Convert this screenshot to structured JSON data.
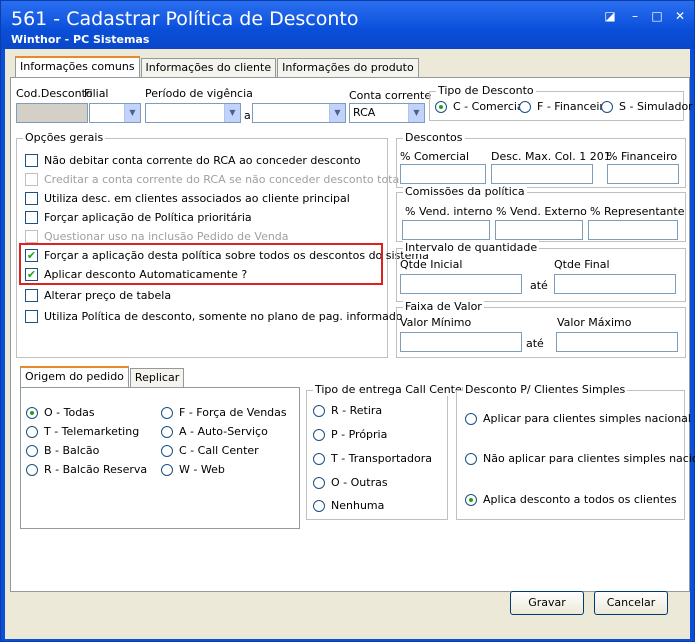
{
  "window": {
    "title": "561 - Cadastrar Política de Desconto",
    "subtitle": "Winthor - PC Sistemas",
    "buttons": {
      "restore": "◪",
      "minimize": "–",
      "maximize": "□",
      "close": "✕"
    }
  },
  "tabs": [
    "Informações comuns",
    "Informações do cliente",
    "Informações do produto"
  ],
  "header": {
    "cod_desconto_label": "Cod.Desconto",
    "filial_label": "Filial",
    "periodo_label": "Período de vigência",
    "a_label": "a",
    "conta_label": "Conta corrente",
    "conta_value": "RCA"
  },
  "tipo_desconto": {
    "title": "Tipo de Desconto",
    "options": [
      "C - Comercial",
      "F - Financeiro",
      "S - Simulador"
    ]
  },
  "opcoes_gerais": {
    "title": "Opções gerais",
    "items": [
      "Não debitar conta corrente do RCA ao conceder desconto",
      "Creditar a conta corrente do RCA se não conceder desconto total",
      "Utiliza desc. em clientes associados ao cliente principal",
      "Forçar aplicação de Política prioritária",
      "Questionar uso na inclusão Pedido de Venda",
      "Forçar a aplicação desta política sobre todos os descontos do sistema",
      "Aplicar desconto Automaticamente ?",
      "Alterar preço de tabela",
      "Utiliza Política de desconto, somente no plano de pag. informado"
    ]
  },
  "descontos": {
    "title": "Descontos",
    "labels": [
      "% Comercial",
      "Desc. Max. Col. 1 201",
      "% Financeiro"
    ]
  },
  "comissoes": {
    "title": "Comissões da política",
    "labels": [
      "% Vend. interno",
      "% Vend. Externo",
      "% Representante"
    ]
  },
  "intervalo": {
    "title": "Intervalo de quantidade",
    "inicial": "Qtde Inicial",
    "ate": "até",
    "final": "Qtde Final"
  },
  "faixa": {
    "title": "Faixa de Valor",
    "minimo": "Valor Mínimo",
    "ate": "até",
    "maximo": "Valor Máximo"
  },
  "sub_tabs": [
    "Origem do pedido",
    "Replicar"
  ],
  "origem": {
    "options": [
      "O - Todas",
      "T - Telemarketing",
      "B - Balcão",
      "R - Balcão Reserva",
      "F - Força de Vendas",
      "A - Auto-Serviço",
      "C - Call Center",
      "W - Web"
    ]
  },
  "tipo_entrega": {
    "title": "Tipo de entrega Call Center",
    "options": [
      "R - Retira",
      "P - Própria",
      "T - Transportadora",
      "O - Outras",
      "Nenhuma"
    ]
  },
  "desconto_simples": {
    "title": "Desconto P/ Clientes Simples",
    "options": [
      "Aplicar para clientes simples nacional",
      "Não aplicar para clientes simples nacional",
      "Aplica desconto a todos os clientes"
    ]
  },
  "buttons": {
    "gravar": "Gravar",
    "cancelar": "Cancelar"
  }
}
